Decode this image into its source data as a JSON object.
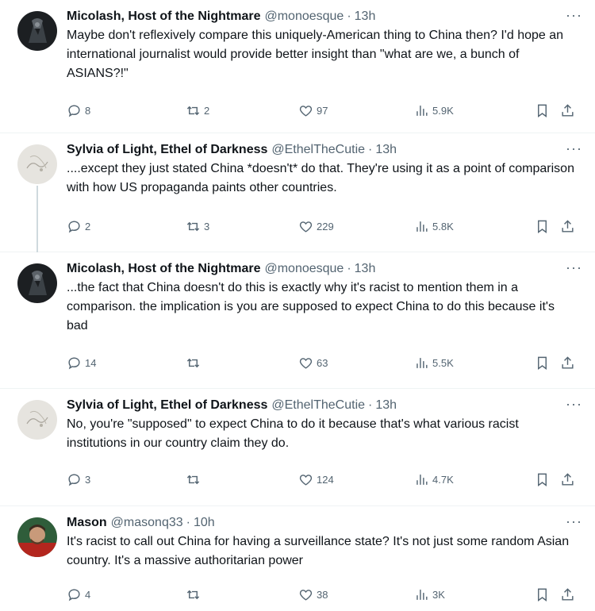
{
  "tweets": [
    {
      "name": "Micolash, Host of the Nightmare",
      "handle": "@monoesque",
      "sep": "·",
      "time": "13h",
      "text": "Maybe don't reflexively compare this uniquely-American thing to China then? I'd hope an international journalist would provide better insight than \"what are we, a bunch of ASIANS?!\"",
      "replies": "8",
      "retweets": "2",
      "likes": "97",
      "views": "5.9K",
      "more": "···"
    },
    {
      "name": "Sylvia of Light, Ethel of Darkness",
      "handle": "@EthelTheCutie",
      "sep": "·",
      "time": "13h",
      "text": "....except they just stated China *doesn't* do that. They're using it as a point of comparison with how US propaganda paints other countries.",
      "replies": "2",
      "retweets": "3",
      "likes": "229",
      "views": "5.8K",
      "more": "···"
    },
    {
      "name": "Micolash, Host of the Nightmare",
      "handle": "@monoesque",
      "sep": "·",
      "time": "13h",
      "text": "...the fact that China doesn't do this is exactly why it's racist to mention them in a comparison. the implication is you are supposed to expect China to do this because it's bad",
      "replies": "14",
      "retweets": "",
      "likes": "63",
      "views": "5.5K",
      "more": "···"
    },
    {
      "name": "Sylvia of Light, Ethel of Darkness",
      "handle": "@EthelTheCutie",
      "sep": "·",
      "time": "13h",
      "text": "No, you're \"supposed\" to expect China to do it because that's what various racist institutions in our country claim they do.",
      "replies": "3",
      "retweets": "",
      "likes": "124",
      "views": "4.7K",
      "more": "···"
    },
    {
      "name": "Mason",
      "handle": "@masonq33",
      "sep": "·",
      "time": "10h",
      "text": "It's racist to call out China for having a surveillance state? It's not just some random Asian country. It's a massive authoritarian power",
      "replies": "4",
      "retweets": "",
      "likes": "38",
      "views": "3K",
      "more": "···"
    }
  ],
  "colors": {
    "text": "#0f1419",
    "secondary": "#536471",
    "divider": "#eff3f4",
    "thread_line": "#cfd9de"
  },
  "icons": [
    "reply-icon",
    "retweet-icon",
    "like-icon",
    "views-icon",
    "bookmark-icon",
    "share-icon",
    "more-icon"
  ]
}
